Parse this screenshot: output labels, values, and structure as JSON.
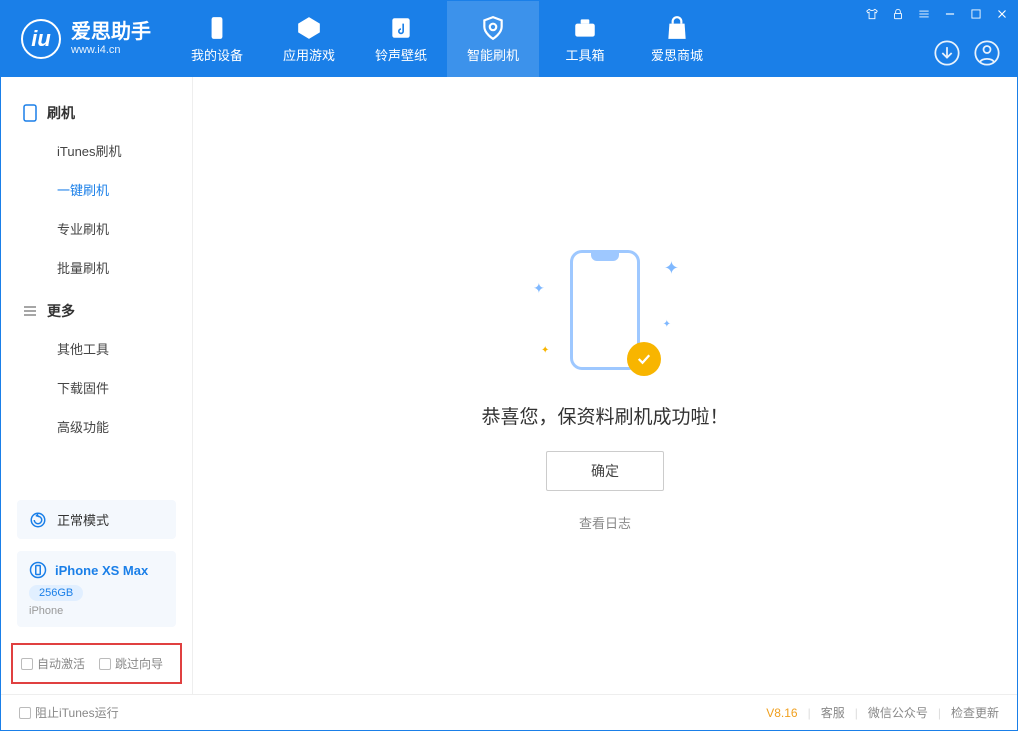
{
  "app": {
    "name_cn": "爱思助手",
    "name_en": "www.i4.cn"
  },
  "nav": {
    "tabs": [
      "我的设备",
      "应用游戏",
      "铃声壁纸",
      "智能刷机",
      "工具箱",
      "爱思商城"
    ],
    "active_index": 3
  },
  "sidebar": {
    "section1": {
      "title": "刷机",
      "items": [
        "iTunes刷机",
        "一键刷机",
        "专业刷机",
        "批量刷机"
      ],
      "active_index": 1
    },
    "section2": {
      "title": "更多",
      "items": [
        "其他工具",
        "下载固件",
        "高级功能"
      ]
    },
    "mode": "正常模式",
    "device": {
      "name": "iPhone XS Max",
      "storage": "256GB",
      "type": "iPhone"
    },
    "opts": {
      "auto_activate": "自动激活",
      "skip_guide": "跳过向导"
    }
  },
  "main": {
    "success": "恭喜您，保资料刷机成功啦！",
    "ok": "确定",
    "view_log": "查看日志"
  },
  "statusbar": {
    "block_itunes": "阻止iTunes运行",
    "version": "V8.16",
    "links": [
      "客服",
      "微信公众号",
      "检查更新"
    ]
  }
}
